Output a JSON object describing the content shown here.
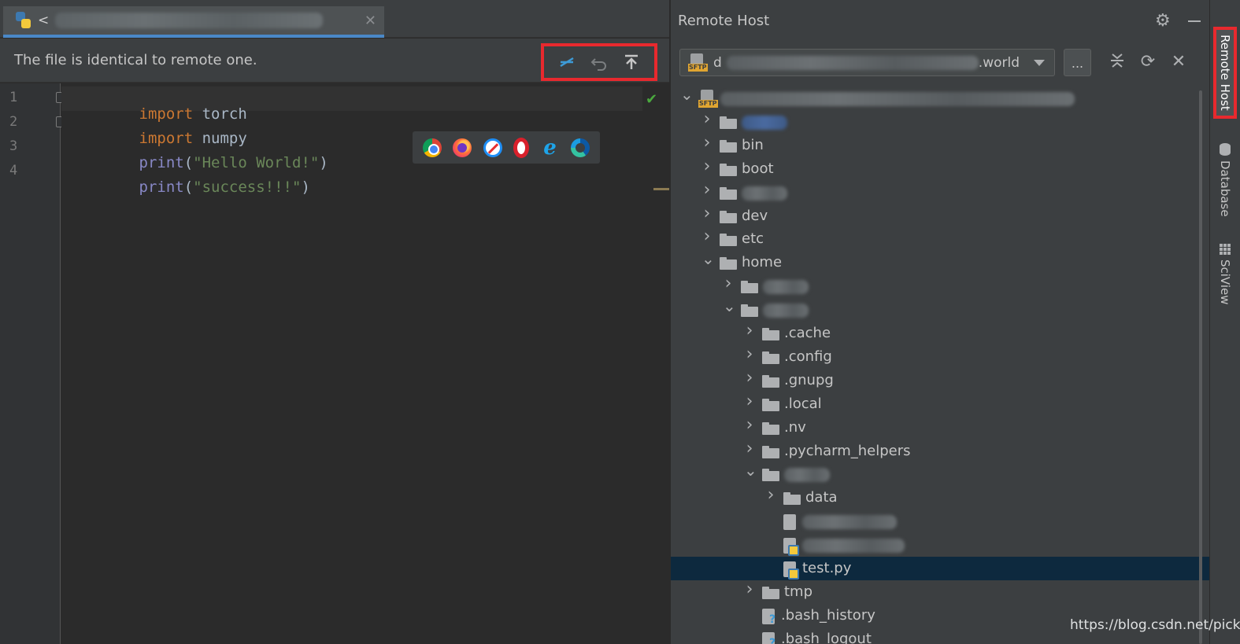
{
  "editor": {
    "tab": {
      "title_visible": "<",
      "close_glyph": "✕"
    },
    "notice": "The file is identical to remote one.",
    "actions": {
      "compare_icon": "compare-arrows-icon",
      "revert_icon": "revert-icon",
      "upload_icon": "upload-icon"
    },
    "line_numbers": [
      "1",
      "2",
      "3",
      "4"
    ],
    "code": {
      "l1_kw": "import",
      "l1_id": " torch",
      "l2_kw": "import",
      "l2_id": " numpy",
      "l3_fn": "print",
      "l3_open": "(",
      "l3_str": "\"Hello World!\"",
      "l3_close": ")",
      "l4_fn": "print",
      "l4_open": "(",
      "l4_str": "\"success!!!\"",
      "l4_close": ")"
    },
    "browsers": [
      "chrome",
      "firefox",
      "safari",
      "opera",
      "ie",
      "edge"
    ]
  },
  "remote_host": {
    "title": "Remote Host",
    "server_prefix": "d",
    "server_suffix": ".world",
    "more_label": "...",
    "tree": [
      {
        "label": "",
        "depth": 0,
        "expanded": true,
        "kind": "server"
      },
      {
        "label": "",
        "depth": 1,
        "expanded": false,
        "kind": "folder"
      },
      {
        "label": "bin",
        "depth": 1,
        "expanded": false,
        "kind": "folder"
      },
      {
        "label": "boot",
        "depth": 1,
        "expanded": false,
        "kind": "folder"
      },
      {
        "label": "",
        "depth": 1,
        "expanded": false,
        "kind": "folder"
      },
      {
        "label": "dev",
        "depth": 1,
        "expanded": false,
        "kind": "folder"
      },
      {
        "label": "etc",
        "depth": 1,
        "expanded": false,
        "kind": "folder"
      },
      {
        "label": "home",
        "depth": 1,
        "expanded": true,
        "kind": "folder"
      },
      {
        "label": "",
        "depth": 2,
        "expanded": false,
        "kind": "folder"
      },
      {
        "label": "",
        "depth": 2,
        "expanded": true,
        "kind": "folder"
      },
      {
        "label": ".cache",
        "depth": 3,
        "expanded": false,
        "kind": "folder"
      },
      {
        "label": ".config",
        "depth": 3,
        "expanded": false,
        "kind": "folder"
      },
      {
        "label": ".gnupg",
        "depth": 3,
        "expanded": false,
        "kind": "folder"
      },
      {
        "label": ".local",
        "depth": 3,
        "expanded": false,
        "kind": "folder"
      },
      {
        "label": ".nv",
        "depth": 3,
        "expanded": false,
        "kind": "folder"
      },
      {
        "label": ".pycharm_helpers",
        "depth": 3,
        "expanded": false,
        "kind": "folder"
      },
      {
        "label": "",
        "depth": 3,
        "expanded": true,
        "kind": "folder"
      },
      {
        "label": "data",
        "depth": 4,
        "expanded": false,
        "kind": "folder"
      },
      {
        "label": "",
        "depth": 4,
        "kind": "file"
      },
      {
        "label": "",
        "depth": 4,
        "kind": "py"
      },
      {
        "label": "test.py",
        "depth": 4,
        "kind": "py",
        "selected": true
      },
      {
        "label": "tmp",
        "depth": 3,
        "expanded": false,
        "kind": "folder"
      },
      {
        "label": ".bash_history",
        "depth": 3,
        "kind": "unknown"
      },
      {
        "label": ".bash_logout",
        "depth": 3,
        "kind": "unknown"
      }
    ]
  },
  "side_tabs": {
    "remote_host": "Remote Host",
    "database": "Database",
    "sciview": "SciView"
  },
  "watermark": "https://blog.csdn.net/pickoak",
  "colors": {
    "highlight_box": "#e8292e",
    "selection": "#0d293e",
    "keyword": "#cc7832",
    "string": "#6a8759"
  }
}
